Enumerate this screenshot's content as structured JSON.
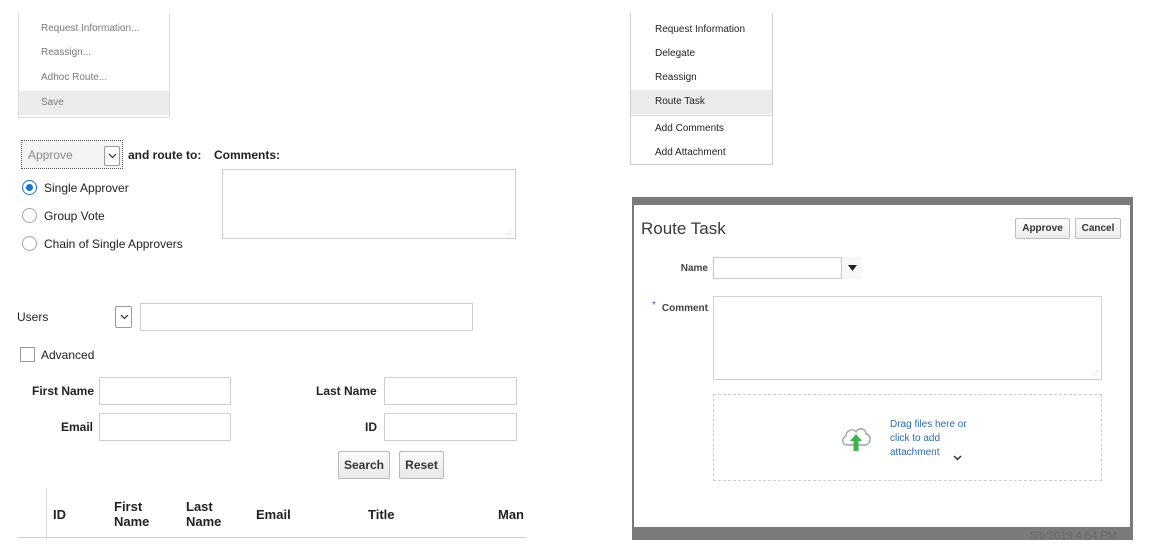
{
  "left_menu": {
    "items": [
      "Request Information...",
      "Reassign...",
      "Adhoc Route...",
      "Save"
    ]
  },
  "approval": {
    "action_value": "Approve",
    "route_label": "and route to:",
    "comments_label": "Comments:",
    "radio_options": [
      "Single Approver",
      "Group Vote",
      "Chain of Single Approvers"
    ]
  },
  "search": {
    "type_value": "Users",
    "advanced_label": "Advanced",
    "first_name_label": "First Name",
    "last_name_label": "Last Name",
    "email_label": "Email",
    "id_label": "ID",
    "search_button": "Search",
    "reset_button": "Reset"
  },
  "results_table": {
    "columns": [
      "ID",
      "First Name",
      "Last Name",
      "Email",
      "Title",
      "Man"
    ]
  },
  "right_menu": {
    "items": [
      "Request Information",
      "Delegate",
      "Reassign",
      "Route Task",
      "Add Comments",
      "Add Attachment"
    ]
  },
  "route_dialog": {
    "title": "Route Task",
    "approve_button": "Approve",
    "cancel_button": "Cancel",
    "name_label": "Name",
    "required_marker": "*",
    "comment_label": "Comment",
    "drop_line1": "Drag files here or",
    "drop_line2": "click to add",
    "drop_line3": "attachment",
    "footer_date": "5/6/2019 4:54 PM"
  },
  "colors": {
    "radio_selected": "#1a73c8",
    "upload_arrow": "#3cb34a",
    "link": "#2b6cb0"
  }
}
